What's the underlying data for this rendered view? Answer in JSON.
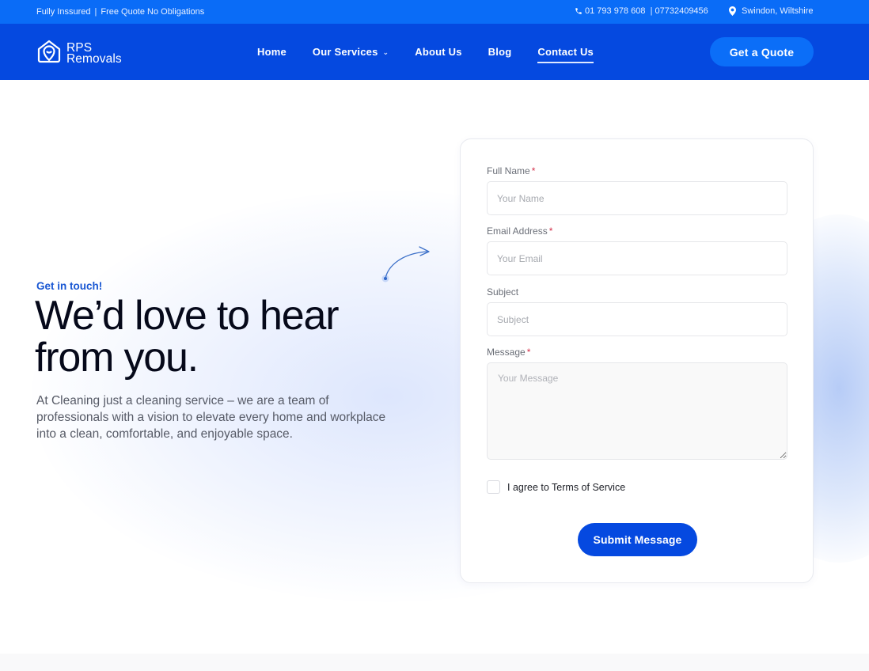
{
  "topbar": {
    "left_items": [
      "Fully Inssured",
      "Free Quote No Obligations"
    ],
    "separator": "|",
    "phone": "01 793 978 608  | 07732409456",
    "location": "Swindon, Wiltshire",
    "icons": {
      "phone": "phone-icon",
      "location": "map-pin-icon"
    }
  },
  "header": {
    "logo_line1": "RPS",
    "logo_line2": "Removals",
    "nav": [
      {
        "label": "Home",
        "active": false
      },
      {
        "label": "Our Services",
        "active": false,
        "has_dropdown": true
      },
      {
        "label": "About Us",
        "active": false
      },
      {
        "label": "Blog",
        "active": false
      },
      {
        "label": "Contact Us",
        "active": true
      }
    ],
    "dropdown_glyph": "⌄",
    "cta_label": "Get a Quote"
  },
  "hero": {
    "eyebrow": "Get in touch!",
    "headline_line1": "We’d love to hear",
    "headline_line2": "from you.",
    "lede": "At Cleaning just a cleaning service – we are a team of professionals with a vision to elevate every home and workplace into a clean, comfortable, and enjoyable space."
  },
  "form": {
    "fields": [
      {
        "label": "Full Name",
        "required": true,
        "placeholder": "Your Name",
        "value": ""
      },
      {
        "label": "Email Address",
        "required": true,
        "placeholder": "Your Email",
        "value": ""
      },
      {
        "label": "Subject",
        "required": false,
        "placeholder": "Subject",
        "value": ""
      },
      {
        "label": "Message",
        "required": true,
        "placeholder": "Your Message",
        "value": ""
      }
    ],
    "required_mark": "*",
    "terms_label": "I agree to Terms of Service",
    "terms_checked": false,
    "submit_label": "Submit Message"
  },
  "colors": {
    "topbar": "#0a6cf7",
    "header": "#0549e0",
    "accent": "#1957d3",
    "required": "#d3304a"
  }
}
